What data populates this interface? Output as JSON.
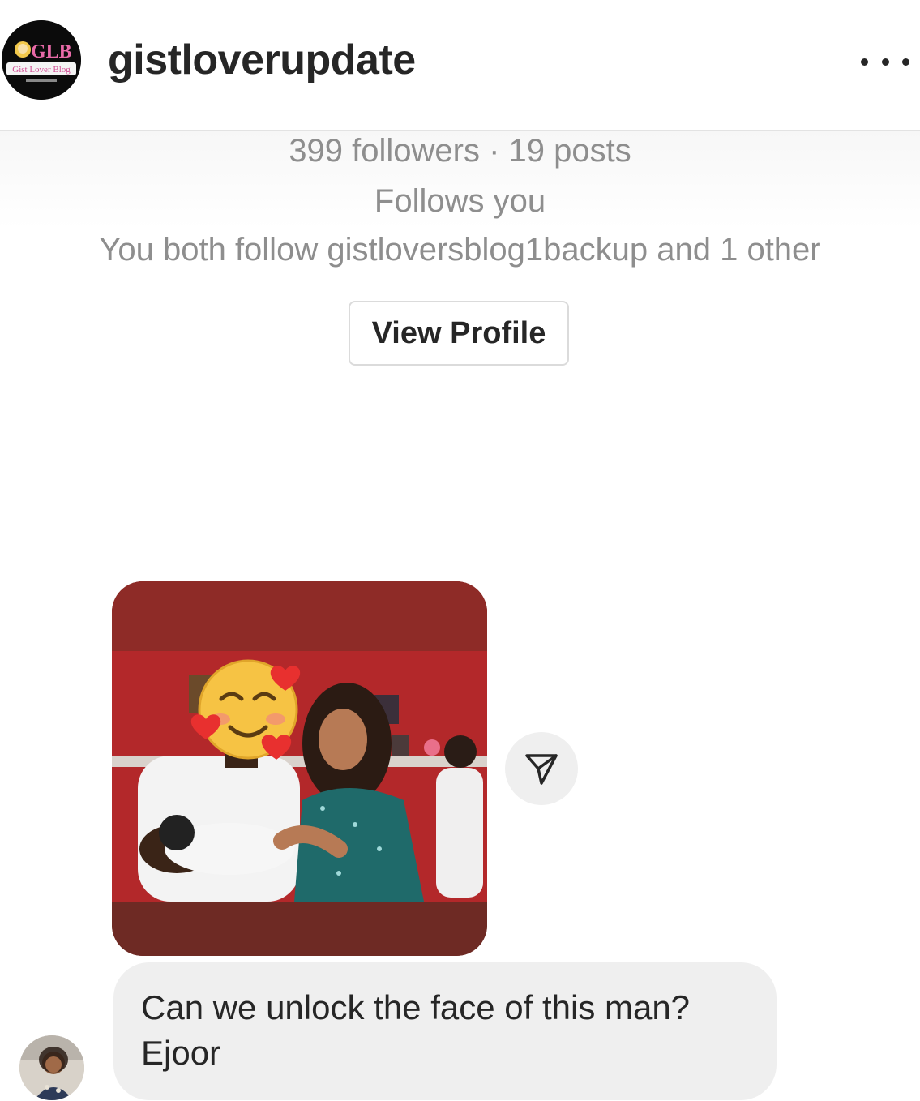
{
  "header": {
    "username": "gistloverupdate",
    "avatar_icon": "gist-lover-blog-logo-icon",
    "logo_text": "GLB",
    "logo_subtext": "Gist Lover Blog",
    "more_icon": "more-horizontal-icon"
  },
  "profile_card": {
    "stats": "399 followers · 19 posts",
    "follows_you": "Follows you",
    "mutual": "You both follow gistloversblog1backup and 1 other",
    "view_profile_label": "View Profile"
  },
  "conversation": {
    "shared_post": {
      "type": "image",
      "description_icons": [
        "smiling-face-with-hearts-emoji"
      ]
    },
    "share_icon": "paper-plane-icon",
    "message": {
      "line1": "Can we unlock the face of this man?",
      "line2": "Ejoor"
    },
    "sender_avatar_icon": "user-avatar-icon"
  },
  "colors": {
    "text": "#262626",
    "muted": "#8e8e8e",
    "bubble": "#efefef",
    "border": "#dbdbdb",
    "post_red": "#b3282a"
  }
}
